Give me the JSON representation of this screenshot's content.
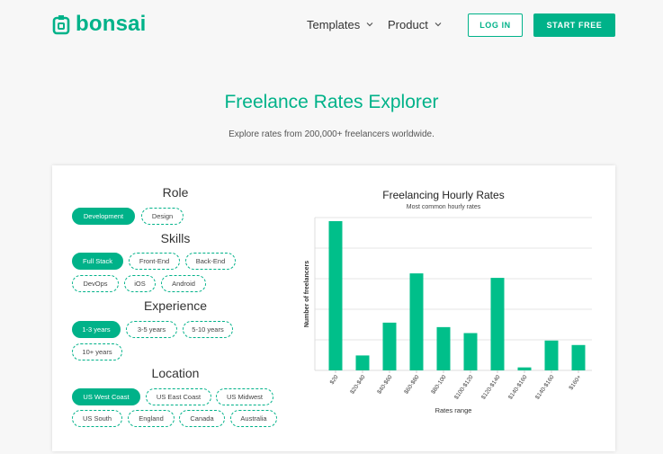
{
  "brand": {
    "name": "bonsai",
    "color": "#00b289"
  },
  "nav": {
    "templates": "Templates",
    "product": "Product",
    "login": "LOG IN",
    "start_free": "START FREE"
  },
  "hero": {
    "title": "Freelance Rates Explorer",
    "subtitle": "Explore rates from 200,000+ freelancers worldwide."
  },
  "filters": {
    "role": {
      "title": "Role",
      "options": [
        "Development",
        "Design"
      ],
      "selected": "Development"
    },
    "skills": {
      "title": "Skills",
      "options": [
        "Full Stack",
        "Front-End",
        "Back-End",
        "DevOps",
        "iOS",
        "Android"
      ],
      "selected": "Full Stack"
    },
    "experience": {
      "title": "Experience",
      "options": [
        "1-3 years",
        "3-5 years",
        "5-10 years",
        "10+ years"
      ],
      "selected": "1-3 years"
    },
    "location": {
      "title": "Location",
      "options": [
        "US West Coast",
        "US East Coast",
        "US Midwest",
        "US South",
        "England",
        "Canada",
        "Australia"
      ],
      "selected": "US West Coast"
    }
  },
  "chart_data": {
    "type": "bar",
    "title": "Freelancing Hourly Rates",
    "subtitle": "Most common hourly rates",
    "xlabel": "Rates range",
    "ylabel": "Number of freelancers",
    "categories": [
      "$20",
      "$20-$40",
      "$40-$60",
      "$60-$80",
      "$80-100",
      "$100-$120",
      "$120-$140",
      "$140-$160",
      "$140-$160",
      "$160+"
    ],
    "values": [
      100,
      10,
      32,
      65,
      29,
      25,
      62,
      2,
      20,
      17
    ],
    "ylim": [
      0,
      100
    ],
    "grid": true,
    "bar_color": "#00bf8a"
  }
}
